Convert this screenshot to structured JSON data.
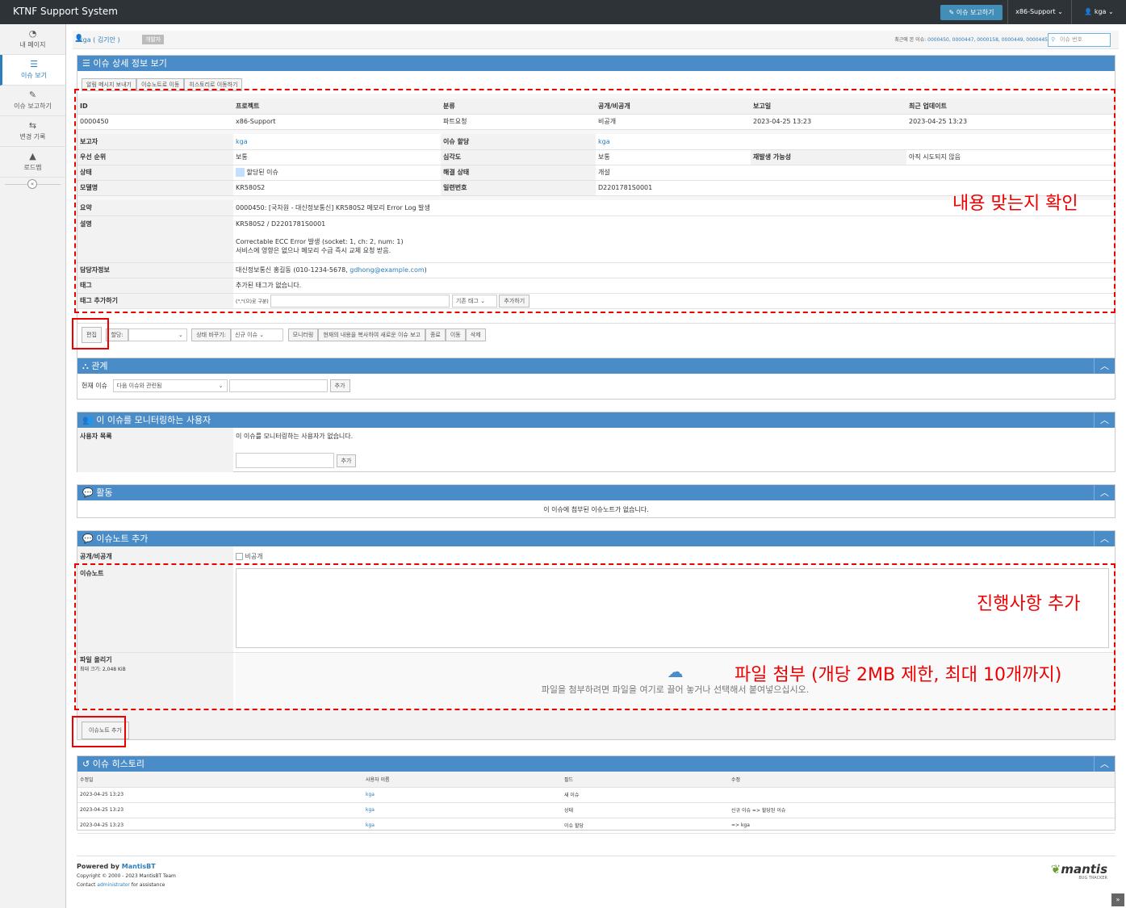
{
  "navbar": {
    "brand": "KTNF Support System",
    "report_button": "이슈 보고하기",
    "project": "x86-Support",
    "user": "kga"
  },
  "sidebar": {
    "items": [
      {
        "label": "내 페이지",
        "icon": "dashboard-icon"
      },
      {
        "label": "이슈 보기",
        "icon": "list-icon"
      },
      {
        "label": "이슈 보고하기",
        "icon": "edit-icon"
      },
      {
        "label": "변경 기록",
        "icon": "retweet-icon"
      },
      {
        "label": "로드맵",
        "icon": "road-icon"
      }
    ]
  },
  "breadcrumb": {
    "user": "kga ( 김기안 )",
    "role": "개발자",
    "recent_label": "최근에 본 이슈:",
    "recent_ids": "0000450, 0000447, 0000158, 0000449, 0000445",
    "search_placeholder": "이슈 번호"
  },
  "issue": {
    "title": "이슈 상세 정보 보기",
    "top_buttons": [
      "알림 메시지 보내기",
      "이슈노트로 이동",
      "히스토리로 이동하기"
    ],
    "headers": [
      "ID",
      "프로젝트",
      "분류",
      "공개/비공개",
      "보고일",
      "최근 업데이트"
    ],
    "values": [
      "0000450",
      "x86-Support",
      "파트요청",
      "비공개",
      "2023-04-25 13:23",
      "2023-04-25 13:23"
    ],
    "reporter_label": "보고자",
    "reporter": "kga",
    "handler_label": "이슈 할당",
    "handler": "kga",
    "priority_label": "우선 순위",
    "priority": "보통",
    "severity_label": "심각도",
    "severity": "보통",
    "repro_label": "재발생 가능성",
    "repro": "아직 시도되지 않음",
    "status_label": "상태",
    "status": "할당된 이슈",
    "resolution_label": "해결 상태",
    "resolution": "개설",
    "model_label": "모델명",
    "model": "KR580S2",
    "serial_label": "일련번호",
    "serial": "D2201781S0001",
    "summary_label": "요약",
    "summary": "0000450: [국차원 - 대신정보통신] KR580S2 메모리 Error Log 발생",
    "desc_label": "설명",
    "desc1": "KR580S2 / D2201781S0001",
    "desc2": "Correctable ECC Error 발생 (socket: 1, ch: 2, num: 1)",
    "desc3": "서비스에 영향은 없으나 메모리 수급 즉시 교체 요청 받음.",
    "contact_label": "담당자정보",
    "contact_text": "대신정보통신 홍길동 (010-1234-5678, ",
    "contact_email": "gdhong@example.com",
    "contact_end": ")",
    "tags_label": "태그",
    "tags": "추가된 태그가 없습니다.",
    "add_tag_label": "태그 추가하기",
    "tag_hint": "(\",\"(으)로 구분)",
    "tag_select": "기존 태그",
    "tag_button": "추가하기",
    "action_buttons": {
      "edit": "편집",
      "assign": "할당:",
      "change_status": "상태 바꾸기:",
      "status_select": "신규 이슈",
      "monitor": "모니터링",
      "clone": "현재의 내용을 복사하여 새로운 이슈 보고",
      "close": "종료",
      "move": "이동",
      "delete": "삭제"
    }
  },
  "relations": {
    "title": "관계",
    "label": "현재 이슈",
    "select": "다음 이슈와 관련됨",
    "button": "추가"
  },
  "monitoring": {
    "title": "이 이슈를 모니터링하는 사용자",
    "label": "사용자 목록",
    "empty": "이 이슈를 모니터링하는 사용자가 없습니다.",
    "button": "추가"
  },
  "activity": {
    "title": "활동",
    "empty": "이 이슈에 첨부된 이슈노트가 없습니다."
  },
  "addnote": {
    "title": "이슈노트 추가",
    "privacy_label": "공개/비공개",
    "privacy_option": "비공개",
    "note_label": "이슈노트",
    "file_label": "파일 올리기",
    "max_size": "최대 크기: 2,048 KiB",
    "drop_text": "파일을 첨부하려면 파일을 여기로 끌어 놓거나 선택해서 붙여넣으십시오.",
    "button": "이슈노트 추가"
  },
  "history": {
    "title": "이슈 히스토리",
    "headers": [
      "수정일",
      "사용자 이름",
      "필드",
      "수정"
    ],
    "rows": [
      [
        "2023-04-25 13:23",
        "kga",
        "새 이슈",
        ""
      ],
      [
        "2023-04-25 13:23",
        "kga",
        "상태",
        "신규 이슈 => 할당된 이슈"
      ],
      [
        "2023-04-25 13:23",
        "kga",
        "이슈 할당",
        "=> kga"
      ]
    ]
  },
  "annotations": {
    "check": "내용 맞는지 확인",
    "progress": "진행사항 추가",
    "attach": "파일 첨부 (개당 2MB 제한, 최대 10개까지)"
  },
  "footer": {
    "powered_prefix": "Powered by ",
    "powered_link": "MantisBT",
    "copyright": "Copyright © 2000 - 2023 MantisBT Team",
    "contact_prefix": "Contact ",
    "contact_link": "administrator",
    "contact_suffix": " for assistance",
    "logo": "mantis",
    "logo_sub": "BUG TRACKER"
  },
  "colors": {
    "accent": "#4a8cc7",
    "navbar": "#2e3338",
    "annotation": "#e00000"
  }
}
